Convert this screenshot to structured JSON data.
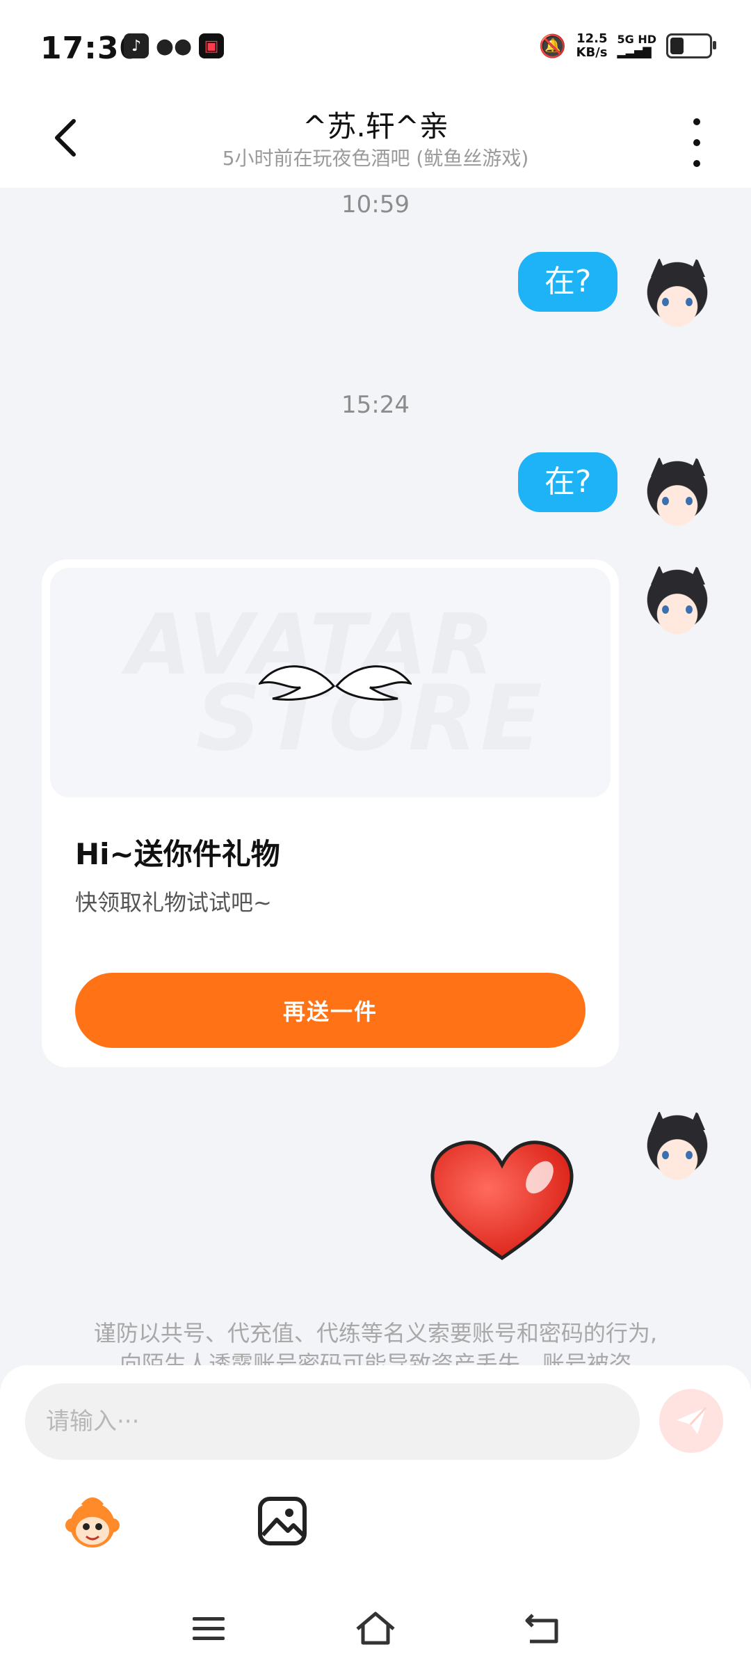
{
  "status_bar": {
    "time": "17:30",
    "net_speed_value": "12.5",
    "net_speed_unit": "KB/s",
    "network_label": "5G HD",
    "battery_level": 0.35
  },
  "header": {
    "title": "^苏.轩^亲",
    "subtitle": "5小时前在玩夜色酒吧 (鱿鱼丝游戏)"
  },
  "messages": [
    {
      "time": "10:59",
      "text": "在?"
    },
    {
      "time": "15:24",
      "text": "在?"
    }
  ],
  "gift_card": {
    "watermark_line1": "AVATAR",
    "watermark_line2": "STORE",
    "title": "Hi~送你件礼物",
    "description": "快领取礼物试试吧~",
    "button_label": "再送一件"
  },
  "warning": {
    "line1": "谨防以共号、代充值、代练等名义索要账号和密码的行为,",
    "line2": "向陌生人透露账号密码可能导致资产丢失、账号被盗"
  },
  "input": {
    "placeholder": "请输入···"
  },
  "icons": {
    "send": "send-icon",
    "emoji": "monkey-emoji-icon",
    "image": "image-icon"
  },
  "colors": {
    "bubble": "#1eb2f6",
    "gift_button": "#ff7316",
    "send_button": "#ffe3e0"
  }
}
